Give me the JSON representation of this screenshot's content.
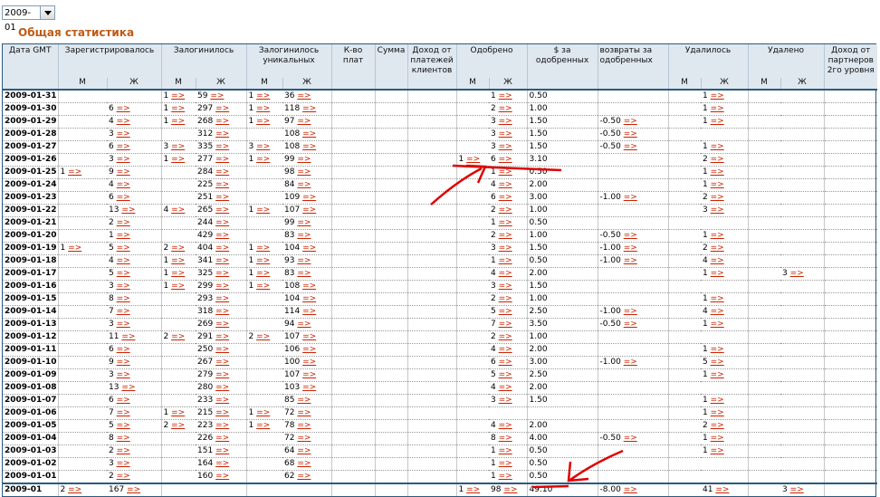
{
  "period_select": {
    "value": "2009-01"
  },
  "page_title": "Общая статистика",
  "arrow_glyph": "=>",
  "headers": {
    "date": "Дата GMT",
    "registered": "Зарегистрировалось",
    "logged": "Залогинилось",
    "logged_unique": "Залогинилось уникальных",
    "pay_count": "К-во плат",
    "sum": "Сумма",
    "client_income": "Доход от платежей клиентов",
    "approved": "Одобрено",
    "approved_usd": "$ за одобренных",
    "returns": "возвраты за одобренных",
    "deleted": "Удалилось",
    "removed": "Удалено",
    "partner_income": "Доход от партнеров 2го уровня",
    "male": "М",
    "female": "Ж"
  },
  "rows": [
    {
      "date": "2009-01-31",
      "regM": "",
      "regF": "",
      "logM": "1",
      "logF": "59",
      "uniM": "1",
      "uniF": "36",
      "cnt": "",
      "sum": "",
      "inc": "",
      "apM": "",
      "apF": "1",
      "usd": "0.50",
      "ret": "",
      "delM": "",
      "delF": "1",
      "remM": "",
      "remF": "",
      "par": ""
    },
    {
      "date": "2009-01-30",
      "regM": "",
      "regF": "6",
      "logM": "1",
      "logF": "297",
      "uniM": "1",
      "uniF": "118",
      "cnt": "",
      "sum": "",
      "inc": "",
      "apM": "",
      "apF": "2",
      "usd": "1.00",
      "ret": "",
      "delM": "",
      "delF": "1",
      "remM": "",
      "remF": "",
      "par": ""
    },
    {
      "date": "2009-01-29",
      "regM": "",
      "regF": "4",
      "logM": "1",
      "logF": "268",
      "uniM": "1",
      "uniF": "97",
      "cnt": "",
      "sum": "",
      "inc": "",
      "apM": "",
      "apF": "3",
      "usd": "1.50",
      "ret": "-0.50",
      "delM": "",
      "delF": "1",
      "remM": "",
      "remF": "",
      "par": ""
    },
    {
      "date": "2009-01-28",
      "regM": "",
      "regF": "3",
      "logM": "",
      "logF": "312",
      "uniM": "",
      "uniF": "108",
      "cnt": "",
      "sum": "",
      "inc": "",
      "apM": "",
      "apF": "3",
      "usd": "1.50",
      "ret": "-0.50",
      "delM": "",
      "delF": "",
      "remM": "",
      "remF": "",
      "par": ""
    },
    {
      "date": "2009-01-27",
      "regM": "",
      "regF": "6",
      "logM": "3",
      "logF": "335",
      "uniM": "3",
      "uniF": "108",
      "cnt": "",
      "sum": "",
      "inc": "",
      "apM": "",
      "apF": "3",
      "usd": "1.50",
      "ret": "-0.50",
      "delM": "",
      "delF": "1",
      "remM": "",
      "remF": "",
      "par": ""
    },
    {
      "date": "2009-01-26",
      "regM": "",
      "regF": "3",
      "logM": "1",
      "logF": "277",
      "uniM": "1",
      "uniF": "99",
      "cnt": "",
      "sum": "",
      "inc": "",
      "apM": "1",
      "apF": "6",
      "usd": "3.10",
      "ret": "",
      "delM": "",
      "delF": "2",
      "remM": "",
      "remF": "",
      "par": ""
    },
    {
      "date": "2009-01-25",
      "regM": "1",
      "regF": "9",
      "logM": "",
      "logF": "284",
      "uniM": "",
      "uniF": "98",
      "cnt": "",
      "sum": "",
      "inc": "",
      "apM": "",
      "apF": "1",
      "usd": "0.50",
      "ret": "",
      "delM": "",
      "delF": "1",
      "remM": "",
      "remF": "",
      "par": ""
    },
    {
      "date": "2009-01-24",
      "regM": "",
      "regF": "4",
      "logM": "",
      "logF": "225",
      "uniM": "",
      "uniF": "84",
      "cnt": "",
      "sum": "",
      "inc": "",
      "apM": "",
      "apF": "4",
      "usd": "2.00",
      "ret": "",
      "delM": "",
      "delF": "1",
      "remM": "",
      "remF": "",
      "par": ""
    },
    {
      "date": "2009-01-23",
      "regM": "",
      "regF": "6",
      "logM": "",
      "logF": "251",
      "uniM": "",
      "uniF": "109",
      "cnt": "",
      "sum": "",
      "inc": "",
      "apM": "",
      "apF": "6",
      "usd": "3.00",
      "ret": "-1.00",
      "delM": "",
      "delF": "2",
      "remM": "",
      "remF": "",
      "par": ""
    },
    {
      "date": "2009-01-22",
      "regM": "",
      "regF": "13",
      "logM": "4",
      "logF": "265",
      "uniM": "1",
      "uniF": "107",
      "cnt": "",
      "sum": "",
      "inc": "",
      "apM": "",
      "apF": "2",
      "usd": "1.00",
      "ret": "",
      "delM": "",
      "delF": "3",
      "remM": "",
      "remF": "",
      "par": ""
    },
    {
      "date": "2009-01-21",
      "regM": "",
      "regF": "2",
      "logM": "",
      "logF": "244",
      "uniM": "",
      "uniF": "99",
      "cnt": "",
      "sum": "",
      "inc": "",
      "apM": "",
      "apF": "1",
      "usd": "0.50",
      "ret": "",
      "delM": "",
      "delF": "",
      "remM": "",
      "remF": "",
      "par": ""
    },
    {
      "date": "2009-01-20",
      "regM": "",
      "regF": "1",
      "logM": "",
      "logF": "429",
      "uniM": "",
      "uniF": "83",
      "cnt": "",
      "sum": "",
      "inc": "",
      "apM": "",
      "apF": "2",
      "usd": "1.00",
      "ret": "-0.50",
      "delM": "",
      "delF": "1",
      "remM": "",
      "remF": "",
      "par": ""
    },
    {
      "date": "2009-01-19",
      "regM": "1",
      "regF": "5",
      "logM": "2",
      "logF": "404",
      "uniM": "1",
      "uniF": "104",
      "cnt": "",
      "sum": "",
      "inc": "",
      "apM": "",
      "apF": "3",
      "usd": "1.50",
      "ret": "-1.00",
      "delM": "",
      "delF": "2",
      "remM": "",
      "remF": "",
      "par": ""
    },
    {
      "date": "2009-01-18",
      "regM": "",
      "regF": "4",
      "logM": "1",
      "logF": "341",
      "uniM": "1",
      "uniF": "93",
      "cnt": "",
      "sum": "",
      "inc": "",
      "apM": "",
      "apF": "1",
      "usd": "0.50",
      "ret": "-1.00",
      "delM": "",
      "delF": "4",
      "remM": "",
      "remF": "",
      "par": ""
    },
    {
      "date": "2009-01-17",
      "regM": "",
      "regF": "5",
      "logM": "1",
      "logF": "325",
      "uniM": "1",
      "uniF": "83",
      "cnt": "",
      "sum": "",
      "inc": "",
      "apM": "",
      "apF": "4",
      "usd": "2.00",
      "ret": "",
      "delM": "",
      "delF": "1",
      "remM": "",
      "remF": "3",
      "par": ""
    },
    {
      "date": "2009-01-16",
      "regM": "",
      "regF": "3",
      "logM": "1",
      "logF": "299",
      "uniM": "1",
      "uniF": "108",
      "cnt": "",
      "sum": "",
      "inc": "",
      "apM": "",
      "apF": "3",
      "usd": "1.50",
      "ret": "",
      "delM": "",
      "delF": "",
      "remM": "",
      "remF": "",
      "par": ""
    },
    {
      "date": "2009-01-15",
      "regM": "",
      "regF": "8",
      "logM": "",
      "logF": "293",
      "uniM": "",
      "uniF": "104",
      "cnt": "",
      "sum": "",
      "inc": "",
      "apM": "",
      "apF": "2",
      "usd": "1.00",
      "ret": "",
      "delM": "",
      "delF": "1",
      "remM": "",
      "remF": "",
      "par": ""
    },
    {
      "date": "2009-01-14",
      "regM": "",
      "regF": "7",
      "logM": "",
      "logF": "318",
      "uniM": "",
      "uniF": "114",
      "cnt": "",
      "sum": "",
      "inc": "",
      "apM": "",
      "apF": "5",
      "usd": "2.50",
      "ret": "-1.00",
      "delM": "",
      "delF": "4",
      "remM": "",
      "remF": "",
      "par": ""
    },
    {
      "date": "2009-01-13",
      "regM": "",
      "regF": "3",
      "logM": "",
      "logF": "269",
      "uniM": "",
      "uniF": "94",
      "cnt": "",
      "sum": "",
      "inc": "",
      "apM": "",
      "apF": "7",
      "usd": "3.50",
      "ret": "-0.50",
      "delM": "",
      "delF": "1",
      "remM": "",
      "remF": "",
      "par": ""
    },
    {
      "date": "2009-01-12",
      "regM": "",
      "regF": "11",
      "logM": "2",
      "logF": "291",
      "uniM": "2",
      "uniF": "107",
      "cnt": "",
      "sum": "",
      "inc": "",
      "apM": "",
      "apF": "2",
      "usd": "1.00",
      "ret": "",
      "delM": "",
      "delF": "",
      "remM": "",
      "remF": "",
      "par": ""
    },
    {
      "date": "2009-01-11",
      "regM": "",
      "regF": "6",
      "logM": "",
      "logF": "250",
      "uniM": "",
      "uniF": "106",
      "cnt": "",
      "sum": "",
      "inc": "",
      "apM": "",
      "apF": "4",
      "usd": "2.00",
      "ret": "",
      "delM": "",
      "delF": "1",
      "remM": "",
      "remF": "",
      "par": ""
    },
    {
      "date": "2009-01-10",
      "regM": "",
      "regF": "9",
      "logM": "",
      "logF": "267",
      "uniM": "",
      "uniF": "100",
      "cnt": "",
      "sum": "",
      "inc": "",
      "apM": "",
      "apF": "6",
      "usd": "3.00",
      "ret": "-1.00",
      "delM": "",
      "delF": "5",
      "remM": "",
      "remF": "",
      "par": ""
    },
    {
      "date": "2009-01-09",
      "regM": "",
      "regF": "3",
      "logM": "",
      "logF": "279",
      "uniM": "",
      "uniF": "107",
      "cnt": "",
      "sum": "",
      "inc": "",
      "apM": "",
      "apF": "5",
      "usd": "2.50",
      "ret": "",
      "delM": "",
      "delF": "1",
      "remM": "",
      "remF": "",
      "par": ""
    },
    {
      "date": "2009-01-08",
      "regM": "",
      "regF": "13",
      "logM": "",
      "logF": "280",
      "uniM": "",
      "uniF": "103",
      "cnt": "",
      "sum": "",
      "inc": "",
      "apM": "",
      "apF": "4",
      "usd": "2.00",
      "ret": "",
      "delM": "",
      "delF": "",
      "remM": "",
      "remF": "",
      "par": ""
    },
    {
      "date": "2009-01-07",
      "regM": "",
      "regF": "6",
      "logM": "",
      "logF": "233",
      "uniM": "",
      "uniF": "85",
      "cnt": "",
      "sum": "",
      "inc": "",
      "apM": "",
      "apF": "3",
      "usd": "1.50",
      "ret": "",
      "delM": "",
      "delF": "1",
      "remM": "",
      "remF": "",
      "par": ""
    },
    {
      "date": "2009-01-06",
      "regM": "",
      "regF": "7",
      "logM": "1",
      "logF": "215",
      "uniM": "1",
      "uniF": "72",
      "cnt": "",
      "sum": "",
      "inc": "",
      "apM": "",
      "apF": "",
      "usd": "",
      "ret": "",
      "delM": "",
      "delF": "1",
      "remM": "",
      "remF": "",
      "par": ""
    },
    {
      "date": "2009-01-05",
      "regM": "",
      "regF": "5",
      "logM": "2",
      "logF": "223",
      "uniM": "1",
      "uniF": "78",
      "cnt": "",
      "sum": "",
      "inc": "",
      "apM": "",
      "apF": "4",
      "usd": "2.00",
      "ret": "",
      "delM": "",
      "delF": "2",
      "remM": "",
      "remF": "",
      "par": ""
    },
    {
      "date": "2009-01-04",
      "regM": "",
      "regF": "8",
      "logM": "",
      "logF": "226",
      "uniM": "",
      "uniF": "72",
      "cnt": "",
      "sum": "",
      "inc": "",
      "apM": "",
      "apF": "8",
      "usd": "4.00",
      "ret": "-0.50",
      "delM": "",
      "delF": "1",
      "remM": "",
      "remF": "",
      "par": ""
    },
    {
      "date": "2009-01-03",
      "regM": "",
      "regF": "2",
      "logM": "",
      "logF": "151",
      "uniM": "",
      "uniF": "64",
      "cnt": "",
      "sum": "",
      "inc": "",
      "apM": "",
      "apF": "1",
      "usd": "0.50",
      "ret": "",
      "delM": "",
      "delF": "1",
      "remM": "",
      "remF": "",
      "par": ""
    },
    {
      "date": "2009-01-02",
      "regM": "",
      "regF": "3",
      "logM": "",
      "logF": "164",
      "uniM": "",
      "uniF": "68",
      "cnt": "",
      "sum": "",
      "inc": "",
      "apM": "",
      "apF": "1",
      "usd": "0.50",
      "ret": "",
      "delM": "",
      "delF": "",
      "remM": "",
      "remF": "",
      "par": ""
    },
    {
      "date": "2009-01-01",
      "regM": "",
      "regF": "2",
      "logM": "",
      "logF": "160",
      "uniM": "",
      "uniF": "62",
      "cnt": "",
      "sum": "",
      "inc": "",
      "apM": "",
      "apF": "1",
      "usd": "0.50",
      "ret": "",
      "delM": "",
      "delF": "",
      "remM": "",
      "remF": "",
      "par": ""
    }
  ],
  "total": {
    "date": "2009-01",
    "regM": "2",
    "regF": "167",
    "logM": "",
    "logF": "",
    "uniM": "",
    "uniF": "",
    "cnt": "",
    "sum": "",
    "inc": "",
    "apM": "1",
    "apF": "98",
    "usd": "49.10",
    "ret": "-8.00",
    "delM": "",
    "delF": "41",
    "remM": "",
    "remF": "3",
    "par": ""
  },
  "annotation_color": "#e00000"
}
